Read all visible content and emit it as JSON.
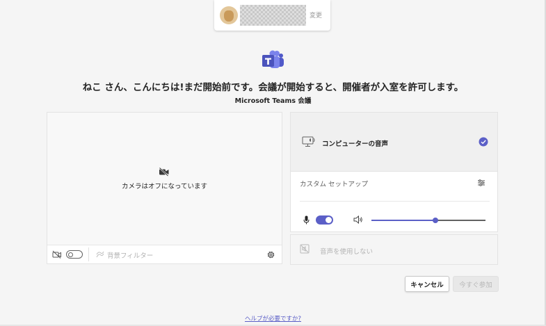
{
  "account": {
    "change_label": "変更",
    "avatar_icon": "cat-avatar"
  },
  "header": {
    "logo_icon": "microsoft-teams-logo",
    "greeting": "ねこ さん、こんにちは!まだ開始前です。会議が開始すると、開催者が入室を許可します。",
    "meeting_label": "Microsoft Teams 会議"
  },
  "video": {
    "camera_off_icon": "camera-off-icon",
    "camera_off_text": "カメラはオフになっています",
    "camera_toggle_on": false,
    "background_filter_label": "背景フィルター"
  },
  "audio": {
    "computer_audio_label": "コンピューターの音声",
    "computer_audio_selected": true,
    "custom_setup_label": "カスタム セットアップ",
    "mic_on": true,
    "volume_level": 0.56,
    "no_audio_label": "音声を使用しない"
  },
  "actions": {
    "cancel_label": "キャンセル",
    "join_label": "今すぐ参加"
  },
  "footer": {
    "help_link": "ヘルプが必要ですか?"
  },
  "colors": {
    "accent": "#5b5fc7",
    "background": "#f5f5f5"
  }
}
